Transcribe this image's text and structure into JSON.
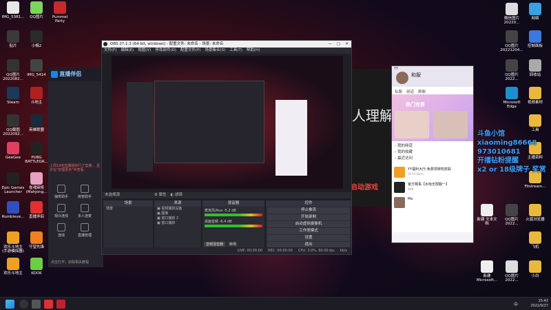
{
  "desktop_left": [
    {
      "label": "IMG_5381...",
      "color": "#e8e8e8"
    },
    {
      "label": "QQ图片",
      "color": "#7bd65b"
    },
    {
      "label": "Pummel Party",
      "color": "#c72a2a"
    },
    {
      "label": "贴片",
      "color": "#3a3a3a"
    },
    {
      "label": "小梅2",
      "color": "#2a2a2a"
    },
    {
      "label": "QQ图片 2022082...",
      "color": "#333"
    },
    {
      "label": "IMG_5414",
      "color": "#444"
    },
    {
      "label": "Steam",
      "color": "#1b3a5a"
    },
    {
      "label": "斗地主",
      "color": "#b02020"
    },
    {
      "label": "QQ截图 2022092...",
      "color": "#333"
    },
    {
      "label": "英雄联盟",
      "color": "#1a2a3a"
    },
    {
      "label": "GeeGee",
      "color": "#e04060"
    },
    {
      "label": "PUBG BATTLEGR...",
      "color": "#222"
    },
    {
      "label": "Epic Games Launcher",
      "color": "#222"
    },
    {
      "label": "雀魂麻将 (Mahjong...",
      "color": "#e8a0c0"
    },
    {
      "label": "Rumbleve...",
      "color": "#3050c0"
    },
    {
      "label": "直播伴侣",
      "color": "#e03030"
    },
    {
      "label": "欢乐斗地主 (手游模拟器)",
      "color": "#f0a020"
    },
    {
      "label": "守望先锋",
      "color": "#f08020"
    },
    {
      "label": "欢乐斗地主",
      "color": "#f0a020"
    },
    {
      "label": "KOOK",
      "color": "#6ad040"
    }
  ],
  "desktop_right": [
    {
      "label": "微信图片 20220...",
      "color": "#ddd"
    },
    {
      "label": "网络",
      "color": "#3aa0e0"
    },
    {
      "label": "QQ图片 20221204...",
      "color": "#444"
    },
    {
      "label": "控制面板",
      "color": "#3a7ae0"
    },
    {
      "label": "QQ图片 2022...",
      "color": "#444"
    },
    {
      "label": "回收站",
      "color": "#aaa"
    },
    {
      "label": "Microsoft Edge",
      "color": "#1a90d0"
    },
    {
      "label": "视频素材",
      "color": "#e8b840"
    },
    {
      "label": "工具",
      "color": "#e8b840"
    },
    {
      "label": "主播资料",
      "color": "#e8b840"
    },
    {
      "label": "Fitstream...",
      "color": "#e8b840"
    },
    {
      "label": "新建 文本文档",
      "color": "#eee"
    },
    {
      "label": "QQ图片 2022...",
      "color": "#444"
    },
    {
      "label": "火狐浏览器",
      "color": "#e8b840"
    },
    {
      "label": "飞机",
      "color": "#e8b840"
    },
    {
      "label": "新建 Microsoft...",
      "color": "#eee"
    },
    {
      "label": "QQ图片 2022...",
      "color": "#ddd"
    },
    {
      "label": "小白",
      "color": "#e8b840"
    }
  ],
  "obs": {
    "title": "OBS 27.1.3 (64-bit, windows) - 配置文件: 未命名 - 场景: 未命名",
    "menu": [
      "文件(F)",
      "编辑(E)",
      "视图(V)",
      "停靠部件(D)",
      "配置文件(P)",
      "场景集合(S)",
      "工具(T)",
      "帮助(H)"
    ],
    "source_bar": "未选择源",
    "props_btn": "属性",
    "filters_btn": "滤镜",
    "docks": {
      "scenes": "场景",
      "sources": "来源",
      "mixer": "混音器",
      "controls": "控件"
    },
    "scene_list": [
      "场景"
    ],
    "source_list": [
      "视频捕获设备",
      "图像",
      "窗口捕获 2",
      "窗口捕获"
    ],
    "mixer": [
      {
        "name": "麦克风/Aux",
        "level": "-5.2 dB"
      },
      {
        "name": "桌面音频",
        "level": "-6.4 dB"
      }
    ],
    "mixer_tabs": [
      "音频混音器",
      "转场"
    ],
    "controls": [
      "停止推流",
      "开始录制",
      "启动虚拟摄像机",
      "工作室模式",
      "设置",
      "退出"
    ],
    "status": {
      "live": "LIVE: 00:00:00",
      "rec": "REC: 00:00:00",
      "cpu": "CPU: 3.0%, 60.00 fps",
      "misc": "kb/s"
    }
  },
  "zhibo": {
    "title": "直播伴侣",
    "notice": "上周19名直播组织行了直播 ，显示在\"管理更多\"中查看",
    "tools": [
      {
        "label": "抽奖助手"
      },
      {
        "label": "房管助手"
      },
      {
        "label": "观众连线"
      },
      {
        "label": "多人连麦"
      },
      {
        "label": "连线"
      },
      {
        "label": "直播管理"
      }
    ],
    "bottom_hint": "点击打开，获取相关教程"
  },
  "stream_title": "人理解",
  "stream_sub": "启动游戏",
  "qq": {
    "title": "YY",
    "user": "和服",
    "tabs": [
      "私聊",
      "频道",
      "群聊"
    ],
    "banner": "热门世界",
    "menu": [
      "我的频道",
      "我的收藏",
      "最近访问"
    ],
    "rows": [
      {
        "name": "YY福利大厅-免费领特权皮肤",
        "meta": "3570.8km"
      },
      {
        "name": "官方赛事【水哈无限服一】",
        "meta": "888"
      },
      {
        "name": "Me",
        "meta": ""
      }
    ]
  },
  "overlay": {
    "lines": [
      "斗鱼小馆",
      "xiaoming86668",
      "973010681",
      "开播钻粉提醒",
      "x2 or 18级牌子 奖赏"
    ]
  },
  "taskbar": {
    "time": "15:42",
    "date": "2022/9/27",
    "lang": "中"
  },
  "colors": {
    "obs_bg": "#1f1e25",
    "accent": "#1b85e6",
    "live_red": "#d82030",
    "overlay_text": "#3aa0ff"
  }
}
